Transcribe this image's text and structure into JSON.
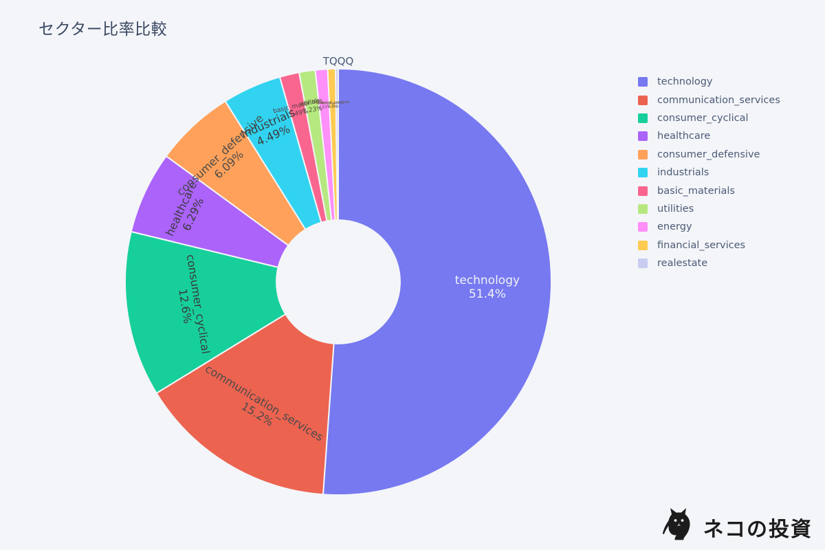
{
  "title": "セクター比率比較",
  "annotation": "TQQQ",
  "background_color": "#f4f5f9",
  "title_color": "#3b4a63",
  "legend": {
    "items": [
      {
        "label": "technology",
        "color": "#7679f0"
      },
      {
        "label": "communication_services",
        "color": "#ec6350"
      },
      {
        "label": "consumer_cyclical",
        "color": "#17cf9b"
      },
      {
        "label": "healthcare",
        "color": "#ab63fa"
      },
      {
        "label": "consumer_defensive",
        "color": "#ffa15a"
      },
      {
        "label": "industrials",
        "color": "#31d3f0"
      },
      {
        "label": "basic_materials",
        "color": "#f8668f"
      },
      {
        "label": "utilities",
        "color": "#b6e880"
      },
      {
        "label": "energy",
        "color": "#ff8ff9"
      },
      {
        "label": "financial_services",
        "color": "#fecb52"
      },
      {
        "label": "realestate",
        "color": "#c7ccf0"
      }
    ]
  },
  "watermark": {
    "text": "ネコの投資",
    "icon": "cat-silhouette-icon"
  },
  "chart_data": {
    "type": "pie",
    "title": "セクター比率比較",
    "subtitle": "TQQQ",
    "hole": 0.29,
    "legend_position": "right",
    "labels": [
      "technology",
      "communication_services",
      "consumer_cyclical",
      "healthcare",
      "consumer_defensive",
      "industrials",
      "basic_materials",
      "utilities",
      "energy",
      "financial_services",
      "realestate"
    ],
    "values": [
      51.4,
      15.2,
      12.6,
      6.29,
      6.09,
      4.49,
      1.49,
      1.23,
      0.93,
      0.6,
      0.2
    ],
    "value_labels": [
      "51.4%",
      "15.2%",
      "12.6%",
      "6.29%",
      "6.09%",
      "4.49%",
      "1.49%",
      "1.23%",
      "0.93%",
      "0.6%",
      "0.2%"
    ],
    "colors": [
      "#7679f0",
      "#ec6350",
      "#17cf9b",
      "#ab63fa",
      "#ffa15a",
      "#31d3f0",
      "#f8668f",
      "#b6e880",
      "#ff8ff9",
      "#fecb52",
      "#c7ccf0"
    ],
    "label_text_colors": [
      "#f2f2f7",
      "#4a4a4a",
      "#3a3a3a",
      "#3a3a3a",
      "#4a4a4a",
      "#3a3a3a",
      "#5a3a48",
      "#4a5a30",
      "#6a4a68",
      "#6a5520",
      "#5a5a6a"
    ],
    "label_font_sizes": [
      17,
      16,
      16,
      16,
      16,
      16,
      9,
      9,
      5.5,
      5.5,
      4
    ],
    "start_angle_deg": 0,
    "direction": "clockwise"
  }
}
